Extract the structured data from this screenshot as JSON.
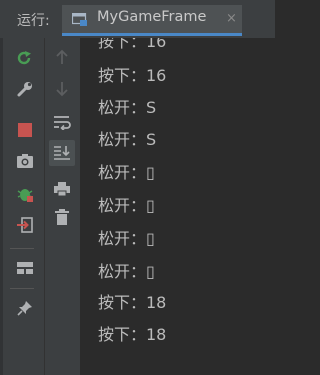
{
  "header": {
    "run_label": "运行:",
    "tab_title": "MyGameFrame",
    "tab_close": "×"
  },
  "toolbar_left": [
    {
      "name": "rerun-icon"
    },
    {
      "name": "wrench-icon"
    },
    {
      "name": "stop-icon"
    },
    {
      "name": "camera-icon"
    },
    {
      "name": "debug-bug-icon"
    },
    {
      "name": "exit-icon"
    },
    {
      "name": "layout-icon"
    },
    {
      "name": "pin-icon"
    }
  ],
  "toolbar_right": [
    {
      "name": "arrow-up-icon"
    },
    {
      "name": "arrow-down-icon"
    },
    {
      "name": "soft-wrap-icon"
    },
    {
      "name": "scroll-to-end-icon"
    },
    {
      "name": "print-icon"
    },
    {
      "name": "trash-icon"
    }
  ],
  "colors": {
    "accent": "#4a88c7",
    "rerun_green": "#499c54",
    "stop_red": "#c75450"
  },
  "console": {
    "lines": [
      "按下：16",
      "按下：16",
      "松开：S",
      "松开：S",
      "松开：▯",
      "松开：▯",
      "松开：▯",
      "松开：▯",
      "按下：18",
      "按下：18"
    ]
  }
}
